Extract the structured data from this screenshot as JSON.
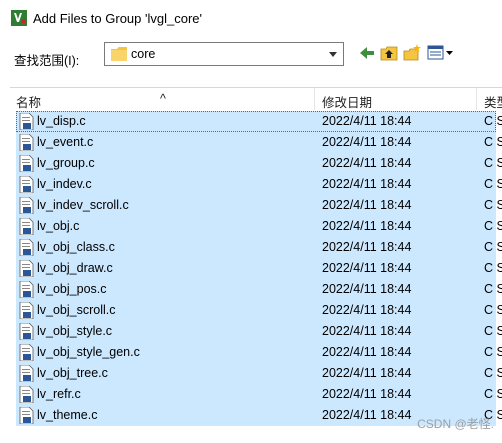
{
  "window": {
    "title": "Add Files to Group 'lvgl_core'"
  },
  "lookin": {
    "label": "查找范围(I):",
    "value": "core"
  },
  "toolbar": {
    "back": "back-icon",
    "up": "up-folder-icon",
    "new": "new-folder-icon",
    "view": "view-menu-icon"
  },
  "columns": {
    "name": "名称",
    "modified": "修改日期",
    "type": "类型"
  },
  "files": [
    {
      "name": "lv_disp.c",
      "date": "2022/4/11 18:44",
      "type": "C S"
    },
    {
      "name": "lv_event.c",
      "date": "2022/4/11 18:44",
      "type": "C S"
    },
    {
      "name": "lv_group.c",
      "date": "2022/4/11 18:44",
      "type": "C S"
    },
    {
      "name": "lv_indev.c",
      "date": "2022/4/11 18:44",
      "type": "C S"
    },
    {
      "name": "lv_indev_scroll.c",
      "date": "2022/4/11 18:44",
      "type": "C S"
    },
    {
      "name": "lv_obj.c",
      "date": "2022/4/11 18:44",
      "type": "C S"
    },
    {
      "name": "lv_obj_class.c",
      "date": "2022/4/11 18:44",
      "type": "C S"
    },
    {
      "name": "lv_obj_draw.c",
      "date": "2022/4/11 18:44",
      "type": "C S"
    },
    {
      "name": "lv_obj_pos.c",
      "date": "2022/4/11 18:44",
      "type": "C S"
    },
    {
      "name": "lv_obj_scroll.c",
      "date": "2022/4/11 18:44",
      "type": "C S"
    },
    {
      "name": "lv_obj_style.c",
      "date": "2022/4/11 18:44",
      "type": "C S"
    },
    {
      "name": "lv_obj_style_gen.c",
      "date": "2022/4/11 18:44",
      "type": "C S"
    },
    {
      "name": "lv_obj_tree.c",
      "date": "2022/4/11 18:44",
      "type": "C S"
    },
    {
      "name": "lv_refr.c",
      "date": "2022/4/11 18:44",
      "type": "C S"
    },
    {
      "name": "lv_theme.c",
      "date": "2022/4/11 18:44",
      "type": "C S"
    }
  ],
  "colors": {
    "selection": "#cce8ff",
    "folder": "#f5c542",
    "accent": "#0078d7"
  },
  "watermark": "CSDN @老怪."
}
